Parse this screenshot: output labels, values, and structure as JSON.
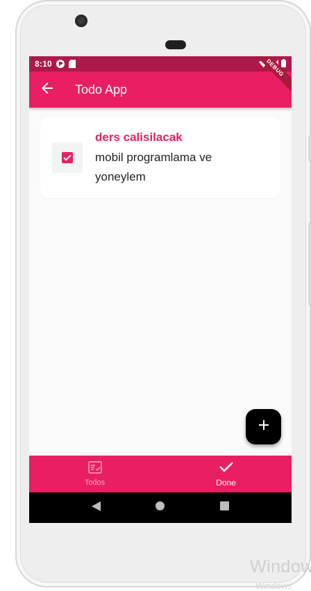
{
  "status_bar": {
    "time": "8:10"
  },
  "debug_banner": "DEBUG",
  "app_bar": {
    "title": "Todo App"
  },
  "todos": [
    {
      "title": "ders calisilacak",
      "description": "mobil programlama ve yoneylem",
      "done": true
    }
  ],
  "bottom_nav": {
    "items": [
      {
        "label": "Todos",
        "icon": "todo-list-icon",
        "active": false
      },
      {
        "label": "Done",
        "icon": "check-icon",
        "active": true
      }
    ]
  },
  "fab": {
    "icon": "add-icon"
  },
  "android_nav": [
    "back-triangle-icon",
    "home-circle-icon",
    "recents-square-icon"
  ],
  "watermark": {
    "line1": "Window",
    "line2": "Windows"
  },
  "colors": {
    "primary": "#e91e63",
    "status_bar": "#ad1a4a",
    "fab": "#000000",
    "background": "#fafafa"
  }
}
